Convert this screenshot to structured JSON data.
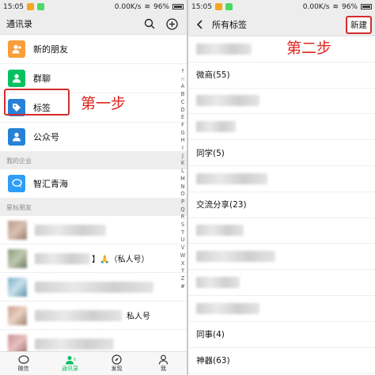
{
  "left": {
    "status": {
      "time": "15:05",
      "speed": "0.00K/s",
      "battery": "96%"
    },
    "header": {
      "title": "通讯录"
    },
    "entries": [
      {
        "label": "新的朋友",
        "color": "#fa9d3b",
        "icon": "add-friend-icon"
      },
      {
        "label": "群聊",
        "color": "#07c160",
        "icon": "group-chat-icon"
      },
      {
        "label": "标签",
        "color": "#2782d7",
        "icon": "tag-icon"
      },
      {
        "label": "公众号",
        "color": "#2782d7",
        "icon": "official-account-icon"
      }
    ],
    "section_company": "我的企业",
    "company": {
      "label": "智汇青海",
      "color": "#2e9df7",
      "icon": "chat-bubble-icon"
    },
    "section_star": "星标朋友",
    "star_rows": [
      {
        "visible_text": ""
      },
      {
        "visible_text": "】🙏（私人号）"
      },
      {
        "visible_text": ""
      },
      {
        "visible_text": "私人号"
      },
      {
        "visible_text": ""
      },
      {
        "visible_text": ""
      }
    ],
    "index": [
      "↑",
      "☆",
      "A",
      "B",
      "C",
      "D",
      "E",
      "F",
      "G",
      "H",
      "I",
      "J",
      "K",
      "L",
      "M",
      "N",
      "O",
      "P",
      "Q",
      "R",
      "S",
      "T",
      "U",
      "V",
      "W",
      "X",
      "Y",
      "Z",
      "#"
    ],
    "tabs": [
      {
        "label": "微信",
        "icon": "chat-icon",
        "active": false
      },
      {
        "label": "通讯录",
        "icon": "contacts-icon",
        "active": true
      },
      {
        "label": "发现",
        "icon": "compass-icon",
        "active": false
      },
      {
        "label": "我",
        "icon": "person-icon",
        "active": false
      }
    ],
    "annotation": "第一步"
  },
  "right": {
    "status": {
      "time": "15:05",
      "speed": "0.00K/s",
      "battery": "96%"
    },
    "header": {
      "title": "所有标签",
      "new_button": "新建"
    },
    "annotation": "第二步",
    "tags": [
      "",
      "微商(55)",
      "",
      "",
      "同学(5)",
      "",
      "交流分享(23)",
      "",
      "",
      "",
      "",
      "同事(4)",
      "神器(63)"
    ]
  },
  "colors": {
    "accent_green": "#07c160",
    "annotation_red": "#e0241e"
  }
}
